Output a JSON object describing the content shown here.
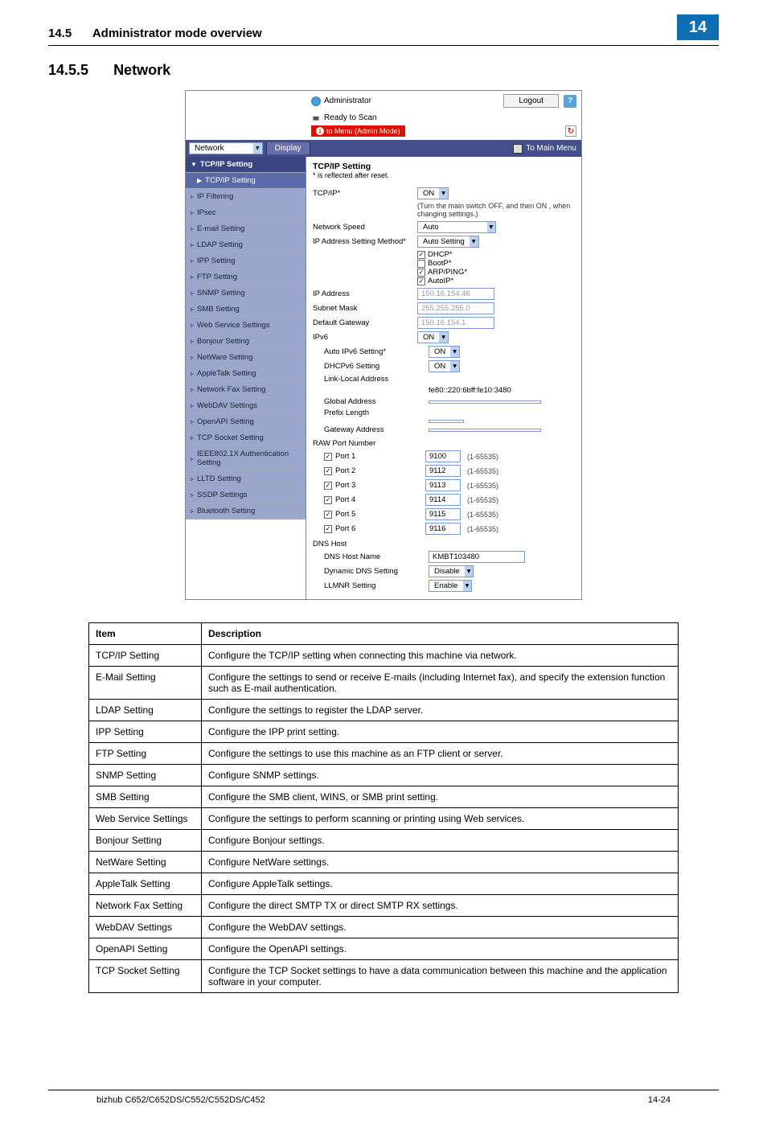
{
  "header": {
    "section": "14.5",
    "title": "Administrator mode overview",
    "chapter": "14"
  },
  "section": {
    "number": "14.5.5",
    "title": "Network"
  },
  "screenshot": {
    "administrator": "Administrator",
    "logout": "Logout",
    "help": "?",
    "status": "Ready to Scan",
    "mode": "to Menu (Admin Mode)",
    "toolbar": {
      "dropdown": "Network",
      "display": "Display",
      "main_menu": "To Main Menu"
    },
    "sidebar": {
      "top": "TCP/IP Setting",
      "sub": "TCP/IP Setting",
      "items": [
        "IP Filtering",
        "IPsec",
        "E-mail Setting",
        "LDAP Setting",
        "IPP Setting",
        "FTP Setting",
        "SNMP Setting",
        "SMB Setting",
        "Web Service Settings",
        "Bonjour Setting",
        "NetWare Setting",
        "AppleTalk Setting",
        "Network Fax Setting",
        "WebDAV Settings",
        "OpenAPI Setting",
        "TCP Socket Setting",
        "IEEE802.1X Authentication Setting",
        "LLTD Setting",
        "SSDP Settings",
        "Bluetooth Setting"
      ]
    },
    "content": {
      "title": "TCP/IP Setting",
      "sub": "* is reflected after reset.",
      "tcpip_label": "TCP/IP*",
      "tcpip_val": "ON",
      "note": "(Turn the main switch OFF, and then ON , when changing settings.)",
      "netspeed_label": "Network Speed",
      "netspeed_val": "Auto",
      "ipmethod_label": "IP Address Setting Method*",
      "ipmethod_val": "Auto Setting",
      "cb_dhcp": "DHCP*",
      "cb_bootp": "BootP*",
      "cb_arp": "ARP/PING*",
      "cb_autoip": "AutoIP*",
      "ipaddr_label": "IP Address",
      "ipaddr_val": "150.16.154.46",
      "subnet_label": "Subnet Mask",
      "subnet_val": "255.255.255.0",
      "gateway_label": "Default Gateway",
      "gateway_val": "150.16.154.1",
      "ipv6_label": "IPv6",
      "ipv6_val": "ON",
      "autoipv6_label": "Auto IPv6 Setting*",
      "autoipv6_val": "ON",
      "dhcpv6_label": "DHCPv6 Setting",
      "dhcpv6_val": "ON",
      "linklocal_label": "Link-Local Address",
      "linklocal_val": "fe80::220:6bff:fe10:3480",
      "globaladdr_label": "Global Address",
      "prefix_label": "Prefix Length",
      "gwaddr_label": "Gateway Address",
      "raw_label": "RAW Port Number",
      "ports": [
        {
          "label": "Port 1",
          "val": "9100"
        },
        {
          "label": "Port 2",
          "val": "9112"
        },
        {
          "label": "Port 3",
          "val": "9113"
        },
        {
          "label": "Port 4",
          "val": "9114"
        },
        {
          "label": "Port 5",
          "val": "9115"
        },
        {
          "label": "Port 6",
          "val": "9116"
        }
      ],
      "port_range": "(1-65535)",
      "dns_host_label": "DNS Host",
      "dns_name_label": "DNS Host Name",
      "dns_name_val": "KMBT103480",
      "dyndns_label": "Dynamic DNS Setting",
      "dyndns_val": "Disable",
      "llmnr_label": "LLMNR Setting",
      "llmnr_val": "Enable"
    }
  },
  "table": {
    "h1": "Item",
    "h2": "Description",
    "rows": [
      {
        "item": "TCP/IP Setting",
        "desc": "Configure the TCP/IP setting when connecting this machine via network."
      },
      {
        "item": "E-Mail Setting",
        "desc": "Configure the settings to send or receive E-mails (including Internet fax), and specify the extension function such as E-mail authentication."
      },
      {
        "item": "LDAP Setting",
        "desc": "Configure the settings to register the LDAP server."
      },
      {
        "item": "IPP Setting",
        "desc": "Configure the IPP print setting."
      },
      {
        "item": "FTP Setting",
        "desc": "Configure the settings to use this machine as an FTP client or server."
      },
      {
        "item": "SNMP Setting",
        "desc": "Configure SNMP settings."
      },
      {
        "item": "SMB Setting",
        "desc": "Configure the SMB client, WINS, or SMB print setting."
      },
      {
        "item": "Web Service Settings",
        "desc": "Configure the settings to perform scanning or printing using Web services."
      },
      {
        "item": "Bonjour Setting",
        "desc": "Configure Bonjour settings."
      },
      {
        "item": "NetWare Setting",
        "desc": "Configure NetWare settings."
      },
      {
        "item": "AppleTalk Setting",
        "desc": "Configure AppleTalk settings."
      },
      {
        "item": "Network Fax Setting",
        "desc": "Configure the direct SMTP TX or direct SMTP RX settings."
      },
      {
        "item": "WebDAV Settings",
        "desc": "Configure the WebDAV settings."
      },
      {
        "item": "OpenAPI Setting",
        "desc": "Configure the OpenAPI settings."
      },
      {
        "item": "TCP Socket Setting",
        "desc": "Configure the TCP Socket settings to have a data communication between this machine and the application software in your computer."
      }
    ]
  },
  "footer": {
    "model": "bizhub C652/C652DS/C552/C552DS/C452",
    "page": "14-24"
  }
}
